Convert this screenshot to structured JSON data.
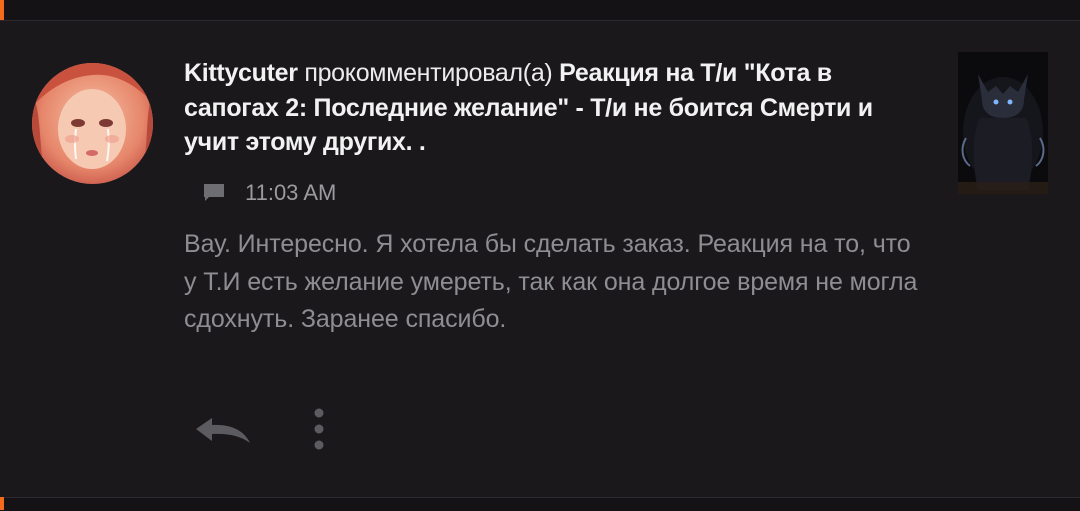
{
  "notification": {
    "username": "Kittycuter",
    "action_text": " прокомментировал(а) ",
    "post_title": "Реакция на Т/и \"Кота в сапогах 2: Последние желание\" - Т/и не боится Смерти и учит этому других. .",
    "timestamp": "11:03 AM",
    "comment_text": "Вау. Интересно. Я хотела бы сделать заказ. Реакция на то, что у Т.И есть желание умереть, так как она долгое время не могла сдохнуть. Заранее спасибо."
  },
  "icons": {
    "comment": "comment-icon",
    "reply": "reply-icon",
    "more": "more-vertical-icon"
  },
  "colors": {
    "background": "#1a181b",
    "accent": "#f26a1b",
    "title_text": "#f2f2f2",
    "body_text": "#8e8e92",
    "icon": "#9a9a9e"
  }
}
